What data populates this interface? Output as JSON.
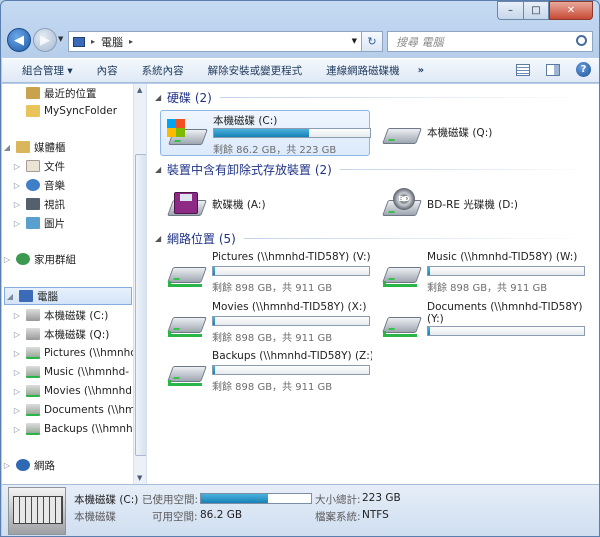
{
  "window": {
    "min": "–",
    "max": "□",
    "close": "✕"
  },
  "address": {
    "path": "電腦",
    "search_placeholder": "搜尋 電腦"
  },
  "toolbar": {
    "items": [
      "組合管理 ▾",
      "內容",
      "系統內容",
      "解除安裝或變更程式",
      "連線網路磁碟機"
    ],
    "more": "»"
  },
  "nav": {
    "recent": "最近的位置",
    "mysync": "MySyncFolder",
    "libraries": "媒體櫃",
    "docs": "文件",
    "music": "音樂",
    "video": "視訊",
    "pictures": "圖片",
    "homegroup": "家用群組",
    "computer": "電腦",
    "c_drive": "本機磁碟 (C:)",
    "q_drive": "本機磁碟 (Q:)",
    "net_v": "Pictures (\\\\hmnhc",
    "net_w": "Music (\\\\hmnhd-",
    "net_x": "Movies (\\\\hmnhd",
    "net_y": "Documents (\\\\hm",
    "net_z": "Backups (\\\\hmnh",
    "network": "網路"
  },
  "groups": {
    "hdd": "硬碟 (2)",
    "removable": "裝置中含有卸除式存放裝置 (2)",
    "netloc": "網路位置 (5)"
  },
  "drives": {
    "c": {
      "name": "本機磁碟 (C:)",
      "free": "剩餘 86.2 GB，共 223 GB",
      "used_fraction": 0.61
    },
    "q": {
      "name": "本機磁碟 (Q:)"
    },
    "a": {
      "name": "軟碟機 (A:)"
    },
    "d": {
      "name": "BD-RE 光碟機 (D:)",
      "badge": "BD"
    },
    "v": {
      "name": "Pictures (\\\\hmnhd-TID58Y) (V:)",
      "free": "剩餘 898 GB，共 911 GB",
      "used_fraction": 0.014
    },
    "w": {
      "name": "Music (\\\\hmnhd-TID58Y) (W:)",
      "free": "剩餘 898 GB，共 911 GB",
      "used_fraction": 0.014
    },
    "x": {
      "name": "Movies (\\\\hmnhd-TID58Y) (X:)",
      "free": "剩餘 898 GB，共 911 GB",
      "used_fraction": 0.014
    },
    "y": {
      "name": "Documents (\\\\hmnhd-TID58Y) (Y:)",
      "used_fraction": 0.014
    },
    "z": {
      "name": "Backups (\\\\hmnhd-TID58Y) (Z:)",
      "free": "剩餘 898 GB，共 911 GB",
      "used_fraction": 0.014
    }
  },
  "status": {
    "name": "本機磁碟 (C:)",
    "type": "本機磁碟",
    "used_label": "已使用空間:",
    "free_label": "可用空間:",
    "free_value": "86.2 GB",
    "total_label": "大小總計:",
    "total_value": "223 GB",
    "fs_label": "檔案系統:",
    "fs_value": "NTFS",
    "used_fraction": 0.61
  }
}
